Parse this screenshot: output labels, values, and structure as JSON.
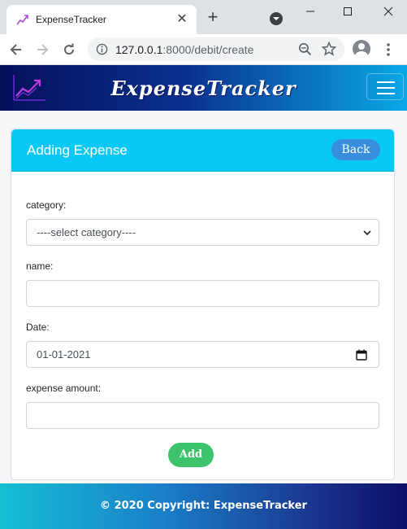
{
  "browser": {
    "tab_title": "ExpenseTracker",
    "url_host": "127.0.0.1",
    "url_path": ":8000/debit/create"
  },
  "navbar": {
    "brand": "ExpenseTracker"
  },
  "card": {
    "title": "Adding Expense",
    "back_label": "Back"
  },
  "form": {
    "category_label": "category:",
    "category_value": "----select category----",
    "name_label": "name:",
    "name_value": "",
    "date_label": "Date:",
    "date_value": "01-01-2021",
    "amount_label": "expense amount:",
    "amount_value": "",
    "submit_label": "Add"
  },
  "footer": {
    "text": "© 2020 Copyright: ExpenseTracker"
  },
  "colors": {
    "header_accent": "#0ac8f5",
    "back_button": "#3a8fdc",
    "add_button": "#3cc36b"
  },
  "icons": [
    "chart-favicon-icon",
    "close-icon",
    "plus-icon",
    "tab-search-icon",
    "minimize-icon",
    "maximize-icon",
    "window-close-icon",
    "arrow-left-icon",
    "arrow-right-icon",
    "reload-icon",
    "info-icon",
    "zoom-icon",
    "star-icon",
    "profile-icon",
    "more-vert-icon",
    "trend-logo-icon",
    "hamburger-icon",
    "chevron-down-icon",
    "calendar-icon"
  ]
}
